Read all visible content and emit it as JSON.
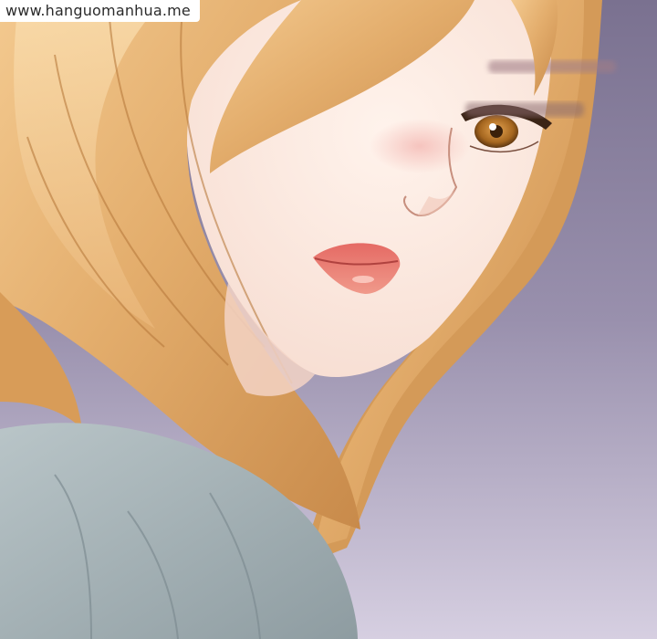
{
  "watermark": {
    "text": "www.hanguomanhua.me"
  },
  "palette": {
    "background": "#8e85a2",
    "hair": "#e1ac69",
    "skin": "#fbe9e0",
    "shirt": "#a9b6b9",
    "lips": "#e9786e",
    "eyes": "#b67a2a"
  }
}
